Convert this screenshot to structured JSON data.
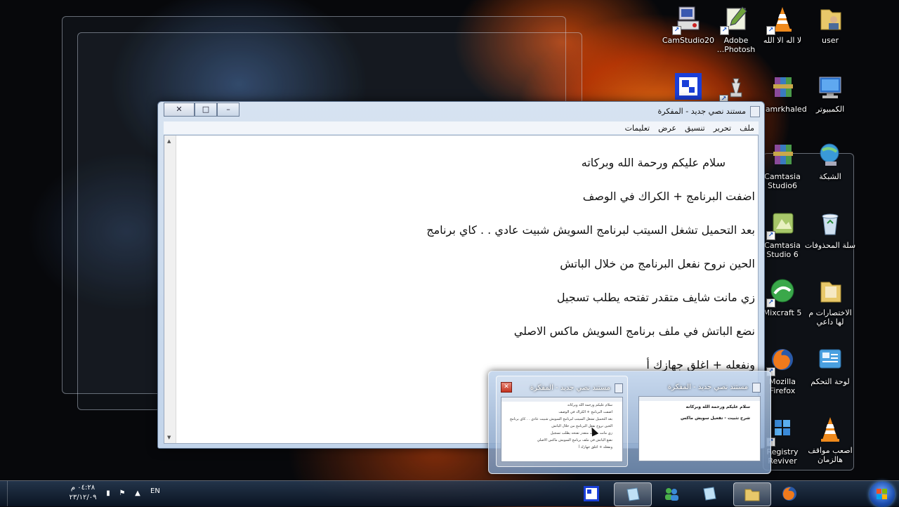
{
  "desktop": {
    "icons": [
      {
        "id": "user",
        "label": "user"
      },
      {
        "id": "vlc1",
        "label": "لا اله الا الله"
      },
      {
        "id": "photoshop",
        "label": "Adobe Photosh..."
      },
      {
        "id": "camstudio",
        "label": "CamStudio20"
      },
      {
        "id": "computer",
        "label": "الكمبيوتر"
      },
      {
        "id": "amrkhaled",
        "label": "amrkhaled..."
      },
      {
        "id": "network",
        "label": "الشبكة"
      },
      {
        "id": "camtasia6a",
        "label": "Camtasia Studio6"
      },
      {
        "id": "recycle",
        "label": "سلة المحذوفات"
      },
      {
        "id": "camtasia6b",
        "label": "Camtasia Studio 6"
      },
      {
        "id": "shortcuts",
        "label": "الاختصارات م لها داعي"
      },
      {
        "id": "mixcraft",
        "label": "Mixcraft 5"
      },
      {
        "id": "controlpanel",
        "label": "لوحة التحكم"
      },
      {
        "id": "firefox",
        "label": "Mozilla Firefox"
      },
      {
        "id": "vlc2",
        "label": "اصعب مواقف هالزمان"
      },
      {
        "id": "registry",
        "label": "Registry Reviver"
      }
    ]
  },
  "notepad": {
    "title": "مستند نصي جديد - المفكرة",
    "controls": {
      "close": "✕",
      "maximize": "□",
      "minimize": "–"
    },
    "menu": [
      "ملف",
      "تحرير",
      "تنسيق",
      "عرض",
      "تعليمات"
    ],
    "lines": [
      "سلام عليكم ورحمة الله وبركاته",
      "اضفت البرنامج + الكراك في الوصف",
      "بعد التحميل تشغل السيتب لبرنامج السويش شبيت عادي . . كاي برنامج",
      "الحين نروح نفعل البرنامج من خلال الباتش",
      "زي مانت شايف متقدر تفتحه يطلب تسجيل",
      "نضع الباتش في ملف برنامج السويش ماكس الاصلي",
      "ونفعله + اغلق جهازك أ"
    ]
  },
  "thumbnails": [
    {
      "title": "مستند نصي جديد - المفكرة",
      "lines_bold": [
        "سلام عليكم ورحمة الله وبركاته",
        "شرح تثبيت - تفعيل سويش ماكس"
      ]
    },
    {
      "title": "مستند نصي جديد - المفكرة",
      "close": "✕"
    }
  ],
  "taskbar": {
    "language": "EN",
    "time": "٠٤:٢٨ م",
    "date": "٢٣/١٢/٠٩"
  },
  "colors": {
    "accent": "#1d4fb0",
    "flag_red": "#f25022",
    "flag_green": "#7fba00",
    "flag_blue": "#00a4ef",
    "flag_yellow": "#ffb900"
  }
}
